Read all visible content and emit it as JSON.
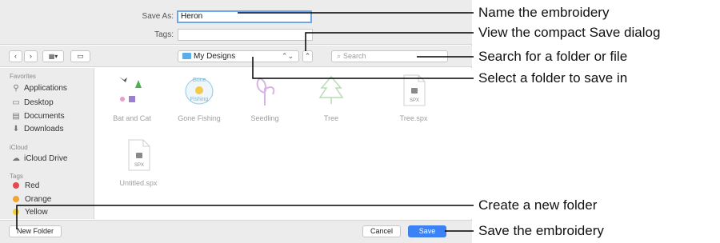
{
  "save_as": {
    "label": "Save As:",
    "value": "Heron"
  },
  "tags": {
    "label": "Tags:",
    "value": ""
  },
  "toolbar": {
    "back_icon": "chevron-left",
    "forward_icon": "chevron-right",
    "view_icon": "grid-view",
    "folder_name": "My Designs",
    "search_placeholder": "Search"
  },
  "sidebar": {
    "favorites_header": "Favorites",
    "favorites": [
      {
        "label": "Applications",
        "icon": "applications"
      },
      {
        "label": "Desktop",
        "icon": "desktop"
      },
      {
        "label": "Documents",
        "icon": "documents"
      },
      {
        "label": "Downloads",
        "icon": "downloads"
      }
    ],
    "icloud_header": "iCloud",
    "icloud": [
      {
        "label": "iCloud Drive",
        "icon": "cloud"
      }
    ],
    "tags_header": "Tags",
    "tags": [
      {
        "label": "Red",
        "color": "#e5484d"
      },
      {
        "label": "Orange",
        "color": "#f3a234"
      },
      {
        "label": "Yellow",
        "color": "#f3d03a"
      }
    ]
  },
  "files": [
    {
      "name": "Bat and Cat",
      "kind": "embroidery"
    },
    {
      "name": "Gone Fishing",
      "kind": "embroidery"
    },
    {
      "name": "Seedling",
      "kind": "embroidery"
    },
    {
      "name": "Tree",
      "kind": "embroidery"
    },
    {
      "name": "Tree.spx",
      "kind": "spx",
      "badge": "SPX"
    },
    {
      "name": "Untitled.spx",
      "kind": "spx",
      "badge": "SPX"
    }
  ],
  "bottom": {
    "new_folder": "New Folder",
    "cancel": "Cancel",
    "save": "Save"
  },
  "callouts": [
    "Name the embroidery",
    "View the compact Save dialog",
    "Search for a folder or file",
    "Select a folder to save in",
    "Create a new folder",
    "Save the embroidery"
  ],
  "colors": {
    "accent": "#3b82f6",
    "folder": "#5aaee8"
  }
}
